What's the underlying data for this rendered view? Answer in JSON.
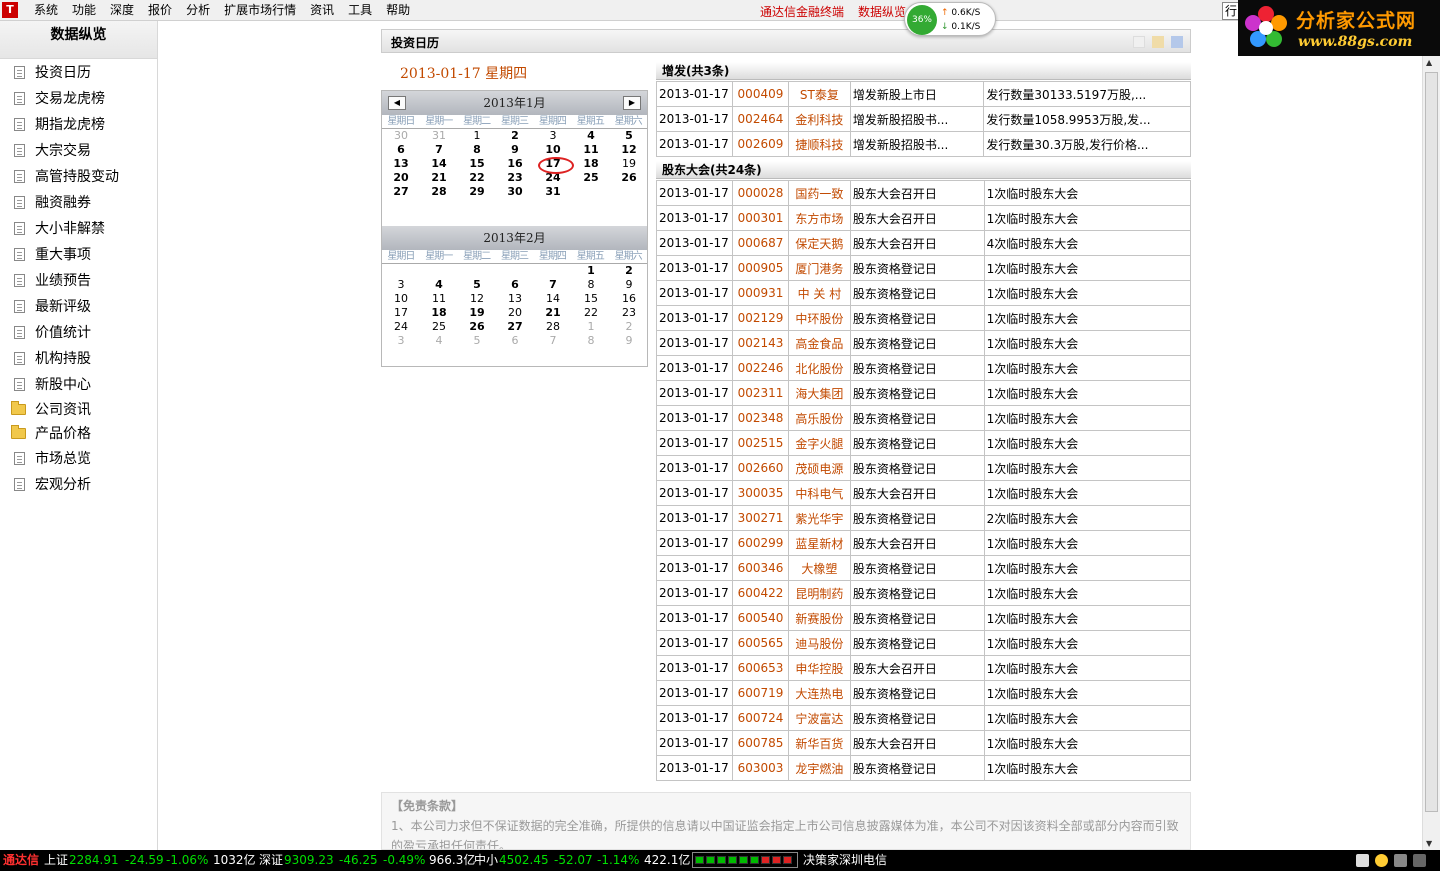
{
  "menubar": {
    "items": [
      "系统",
      "功能",
      "深度",
      "报价",
      "分析",
      "扩展市场行情",
      "资讯",
      "工具",
      "帮助"
    ],
    "links": [
      "通达信金融终端",
      "数据纵览"
    ],
    "trade_label": "行"
  },
  "speed": {
    "percent": "36%",
    "up": "0.6K/S",
    "down": "0.1K/S"
  },
  "brand": {
    "title": "分析家公式网",
    "url": "www.88gs.com"
  },
  "sidebar": {
    "title": "数据纵览",
    "items": [
      {
        "label": "投资日历",
        "type": "doc"
      },
      {
        "label": "交易龙虎榜",
        "type": "doc"
      },
      {
        "label": "期指龙虎榜",
        "type": "doc"
      },
      {
        "label": "大宗交易",
        "type": "doc"
      },
      {
        "label": "高管持股变动",
        "type": "doc"
      },
      {
        "label": "融资融券",
        "type": "doc"
      },
      {
        "label": "大小非解禁",
        "type": "doc"
      },
      {
        "label": "重大事项",
        "type": "doc"
      },
      {
        "label": "业绩预告",
        "type": "doc"
      },
      {
        "label": "最新评级",
        "type": "doc"
      },
      {
        "label": "价值统计",
        "type": "doc"
      },
      {
        "label": "机构持股",
        "type": "doc"
      },
      {
        "label": "新股中心",
        "type": "doc"
      },
      {
        "label": "公司资讯",
        "type": "folder"
      },
      {
        "label": "产品价格",
        "type": "folder"
      },
      {
        "label": "市场总览",
        "type": "doc"
      },
      {
        "label": "宏观分析",
        "type": "doc"
      }
    ]
  },
  "content": {
    "title": "投资日历",
    "date_title": "2013-01-17  星期四"
  },
  "calendar": {
    "weekdays": [
      "星期日",
      "星期一",
      "星期二",
      "星期三",
      "星期四",
      "星期五",
      "星期六"
    ],
    "months": [
      {
        "title": "2013年1月",
        "days": [
          {
            "d": "30",
            "s": "o"
          },
          {
            "d": "31",
            "s": "o"
          },
          {
            "d": "1",
            "s": ""
          },
          {
            "d": "2",
            "s": "b"
          },
          {
            "d": "3",
            "s": ""
          },
          {
            "d": "4",
            "s": "b"
          },
          {
            "d": "5",
            "s": "b"
          },
          {
            "d": "6",
            "s": "b"
          },
          {
            "d": "7",
            "s": "b"
          },
          {
            "d": "8",
            "s": "b"
          },
          {
            "d": "9",
            "s": "b"
          },
          {
            "d": "10",
            "s": "b"
          },
          {
            "d": "11",
            "s": "b"
          },
          {
            "d": "12",
            "s": "b"
          },
          {
            "d": "13",
            "s": "b"
          },
          {
            "d": "14",
            "s": "b"
          },
          {
            "d": "15",
            "s": "b"
          },
          {
            "d": "16",
            "s": "b"
          },
          {
            "d": "17",
            "s": "today"
          },
          {
            "d": "18",
            "s": "b"
          },
          {
            "d": "19",
            "s": ""
          },
          {
            "d": "20",
            "s": "b"
          },
          {
            "d": "21",
            "s": "b"
          },
          {
            "d": "22",
            "s": "b"
          },
          {
            "d": "23",
            "s": "b"
          },
          {
            "d": "24",
            "s": "b"
          },
          {
            "d": "25",
            "s": "b"
          },
          {
            "d": "26",
            "s": "b"
          },
          {
            "d": "27",
            "s": "b"
          },
          {
            "d": "28",
            "s": "b"
          },
          {
            "d": "29",
            "s": "b"
          },
          {
            "d": "30",
            "s": "b"
          },
          {
            "d": "31",
            "s": "b"
          }
        ]
      },
      {
        "title": "2013年2月",
        "days": [
          {
            "d": "",
            "s": ""
          },
          {
            "d": "",
            "s": ""
          },
          {
            "d": "",
            "s": ""
          },
          {
            "d": "",
            "s": ""
          },
          {
            "d": "",
            "s": ""
          },
          {
            "d": "1",
            "s": "b"
          },
          {
            "d": "2",
            "s": "b"
          },
          {
            "d": "3",
            "s": ""
          },
          {
            "d": "4",
            "s": "b"
          },
          {
            "d": "5",
            "s": "b"
          },
          {
            "d": "6",
            "s": "b"
          },
          {
            "d": "7",
            "s": "b"
          },
          {
            "d": "8",
            "s": ""
          },
          {
            "d": "9",
            "s": ""
          },
          {
            "d": "10",
            "s": ""
          },
          {
            "d": "11",
            "s": ""
          },
          {
            "d": "12",
            "s": ""
          },
          {
            "d": "13",
            "s": ""
          },
          {
            "d": "14",
            "s": ""
          },
          {
            "d": "15",
            "s": ""
          },
          {
            "d": "16",
            "s": ""
          },
          {
            "d": "17",
            "s": ""
          },
          {
            "d": "18",
            "s": "b"
          },
          {
            "d": "19",
            "s": "b"
          },
          {
            "d": "20",
            "s": ""
          },
          {
            "d": "21",
            "s": "b"
          },
          {
            "d": "22",
            "s": ""
          },
          {
            "d": "23",
            "s": ""
          },
          {
            "d": "24",
            "s": ""
          },
          {
            "d": "25",
            "s": ""
          },
          {
            "d": "26",
            "s": "b"
          },
          {
            "d": "27",
            "s": "b"
          },
          {
            "d": "28",
            "s": ""
          },
          {
            "d": "1",
            "s": "o"
          },
          {
            "d": "2",
            "s": "o"
          },
          {
            "d": "3",
            "s": "o"
          },
          {
            "d": "4",
            "s": "o"
          },
          {
            "d": "5",
            "s": "o"
          },
          {
            "d": "6",
            "s": "o"
          },
          {
            "d": "7",
            "s": "o"
          },
          {
            "d": "8",
            "s": "o"
          },
          {
            "d": "9",
            "s": "o"
          }
        ]
      }
    ]
  },
  "sections": [
    {
      "title": "增发(共3条)",
      "rows": [
        [
          "2013-01-17",
          "000409",
          "ST泰复",
          "增发新股上市日",
          "发行数量30133.5197万股,..."
        ],
        [
          "2013-01-17",
          "002464",
          "金利科技",
          "增发新股招股书...",
          "发行数量1058.9953万股,发..."
        ],
        [
          "2013-01-17",
          "002609",
          "捷顺科技",
          "增发新股招股书...",
          "发行数量30.3万股,发行价格..."
        ]
      ]
    },
    {
      "title": "股东大会(共24条)",
      "rows": [
        [
          "2013-01-17",
          "000028",
          "国药一致",
          "股东大会召开日",
          "1次临时股东大会"
        ],
        [
          "2013-01-17",
          "000301",
          "东方市场",
          "股东大会召开日",
          "1次临时股东大会"
        ],
        [
          "2013-01-17",
          "000687",
          "保定天鹅",
          "股东大会召开日",
          "4次临时股东大会"
        ],
        [
          "2013-01-17",
          "000905",
          "厦门港务",
          "股东资格登记日",
          "1次临时股东大会"
        ],
        [
          "2013-01-17",
          "000931",
          "中 关 村",
          "股东资格登记日",
          "1次临时股东大会"
        ],
        [
          "2013-01-17",
          "002129",
          "中环股份",
          "股东资格登记日",
          "1次临时股东大会"
        ],
        [
          "2013-01-17",
          "002143",
          "高金食品",
          "股东资格登记日",
          "1次临时股东大会"
        ],
        [
          "2013-01-17",
          "002246",
          "北化股份",
          "股东资格登记日",
          "1次临时股东大会"
        ],
        [
          "2013-01-17",
          "002311",
          "海大集团",
          "股东资格登记日",
          "1次临时股东大会"
        ],
        [
          "2013-01-17",
          "002348",
          "高乐股份",
          "股东资格登记日",
          "1次临时股东大会"
        ],
        [
          "2013-01-17",
          "002515",
          "金字火腿",
          "股东资格登记日",
          "1次临时股东大会"
        ],
        [
          "2013-01-17",
          "002660",
          "茂硕电源",
          "股东资格登记日",
          "1次临时股东大会"
        ],
        [
          "2013-01-17",
          "300035",
          "中科电气",
          "股东大会召开日",
          "1次临时股东大会"
        ],
        [
          "2013-01-17",
          "300271",
          "紫光华宇",
          "股东资格登记日",
          "2次临时股东大会"
        ],
        [
          "2013-01-17",
          "600299",
          "蓝星新材",
          "股东大会召开日",
          "1次临时股东大会"
        ],
        [
          "2013-01-17",
          "600346",
          "大橡塑",
          "股东资格登记日",
          "1次临时股东大会"
        ],
        [
          "2013-01-17",
          "600422",
          "昆明制药",
          "股东资格登记日",
          "1次临时股东大会"
        ],
        [
          "2013-01-17",
          "600540",
          "新赛股份",
          "股东资格登记日",
          "1次临时股东大会"
        ],
        [
          "2013-01-17",
          "600565",
          "迪马股份",
          "股东资格登记日",
          "1次临时股东大会"
        ],
        [
          "2013-01-17",
          "600653",
          "申华控股",
          "股东大会召开日",
          "1次临时股东大会"
        ],
        [
          "2013-01-17",
          "600719",
          "大连热电",
          "股东资格登记日",
          "1次临时股东大会"
        ],
        [
          "2013-01-17",
          "600724",
          "宁波富达",
          "股东资格登记日",
          "1次临时股东大会"
        ],
        [
          "2013-01-17",
          "600785",
          "新华百货",
          "股东大会召开日",
          "1次临时股东大会"
        ],
        [
          "2013-01-17",
          "603003",
          "龙宇燃油",
          "股东资格登记日",
          "1次临时股东大会"
        ]
      ]
    }
  ],
  "disclaimer": {
    "title": "【免责条款】",
    "text": "1、本公司力求但不保证数据的完全准确，所提供的信息请以中国证监会指定上市公司信息披露媒体为准，本公司不对因该资料全部或部分内容而引致的盈亏承担任何责任。"
  },
  "statusbar": {
    "brand": "通达信",
    "sh_label": "上证",
    "sh_index": "2284.91",
    "sh_change": "-24.59",
    "sh_pct": "-1.06%",
    "sh_vol": "1032亿",
    "sz_label": "深证",
    "sz_index": "9309.23",
    "sz_change": "-46.25",
    "sz_pct": "-0.49%",
    "sz_vol": "966.3亿",
    "zx_label": "中小",
    "zx_index": "4502.45",
    "zx_change": "-52.07",
    "zx_pct": "-1.14%",
    "zx_vol": "422.1亿",
    "server": "决策家深圳电信"
  },
  "colors": {
    "accent_orange": "#c24a00",
    "status_red": "#ff3030",
    "status_green": "#00e000"
  }
}
